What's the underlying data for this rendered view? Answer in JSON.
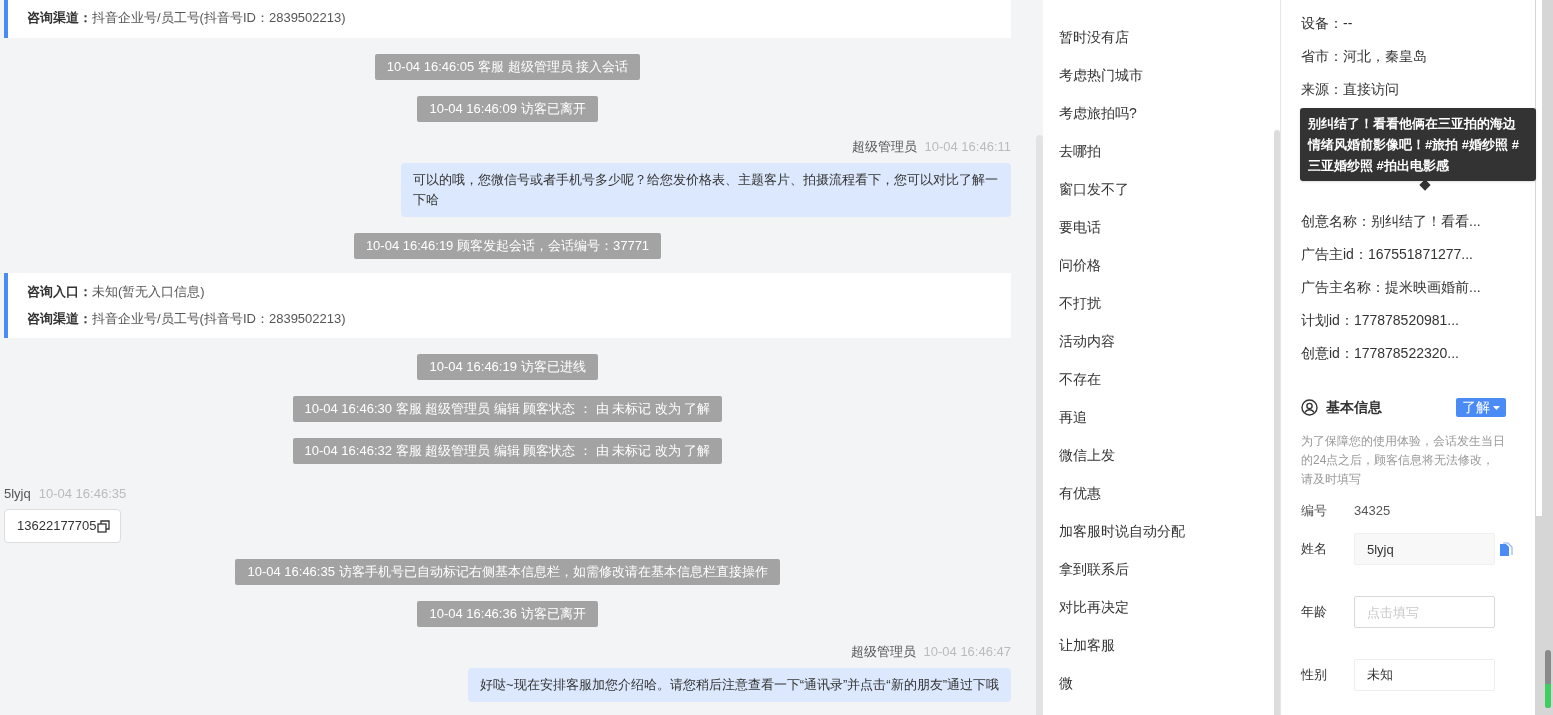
{
  "chat": {
    "items": [
      {
        "kind": "source_card",
        "rows": [
          {
            "label": "咨询渠道：",
            "value": "抖音企业号/员工号(抖音号ID：2839502213)"
          }
        ]
      },
      {
        "kind": "system",
        "text": "10-04 16:46:05 客服 超级管理员 接入会话"
      },
      {
        "kind": "system",
        "text": "10-04 16:46:09 访客已离开"
      },
      {
        "kind": "agent_message",
        "sender": "超级管理员",
        "time": "10-04 16:46:11",
        "text": "可以的哦，您微信号或者手机号多少呢？给您发价格表、主题客片、拍摄流程看下，您可以对比了解一下哈"
      },
      {
        "kind": "system",
        "text": "10-04 16:46:19 顾客发起会话，会话编号：37771"
      },
      {
        "kind": "source_card",
        "rows": [
          {
            "label": "咨询入口：",
            "value": "未知(暂无入口信息)"
          },
          {
            "label": "咨询渠道：",
            "value": "抖音企业号/员工号(抖音号ID：2839502213)"
          }
        ]
      },
      {
        "kind": "system",
        "text": "10-04 16:46:19 访客已进线"
      },
      {
        "kind": "system",
        "text": "10-04 16:46:30 客服 超级管理员 编辑 顾客状态 ： 由 未标记 改为 了解"
      },
      {
        "kind": "system",
        "text": "10-04 16:46:32 客服 超级管理员 编辑 顾客状态 ： 由 未标记 改为 了解"
      },
      {
        "kind": "visitor_message",
        "sender": "5lyjq",
        "time": "10-04 16:46:35",
        "text": "13622177705"
      },
      {
        "kind": "system",
        "text": "10-04 16:46:35 访客手机号已自动标记右侧基本信息栏，如需修改请在基本信息栏直接操作"
      },
      {
        "kind": "system",
        "text": "10-04 16:46:36 访客已离开"
      },
      {
        "kind": "agent_message",
        "sender": "超级管理员",
        "time": "10-04 16:46:47",
        "text": "好哒~现在安排客服加您介绍哈。请您稍后注意查看一下“通讯录”并点击“新的朋友”通过下哦"
      }
    ]
  },
  "quick_replies": [
    "暂时没有店",
    "考虑热门城市",
    "考虑旅拍吗?",
    "去哪拍",
    "窗口发不了",
    "要电话",
    "问价格",
    "不打扰",
    "活动内容",
    "不存在",
    "再追",
    "微信上发",
    "有优惠",
    "加客服时说自动分配",
    "拿到联系后",
    "对比再决定",
    "让加客服",
    "微"
  ],
  "visitor_info": {
    "fields_above": [
      "设备：--",
      "省市：河北，秦皇岛",
      "来源：直接访问"
    ],
    "tooltip": "别纠结了！看看他俩在三亚拍的海边情绪风婚前影像吧！#旅拍 #婚纱照 #三亚婚纱照 #拍出电影感",
    "fields_below": [
      "创意名称：别纠结了！看看...",
      "广告主id：167551871277...",
      "广告主名称：提米映画婚前...",
      "计划id：177878520981...",
      "创意id：177878522320..."
    ]
  },
  "basic_info": {
    "title": "基本信息",
    "status": "了解",
    "note": "为了保障您的使用体验，会话发生当日的24点之后，顾客信息将无法修改，请及时填写",
    "number_label": "编号",
    "number": "34325",
    "fields": [
      {
        "label": "姓名",
        "value": "5lyjq",
        "kind": "readonly"
      },
      {
        "label": "年龄",
        "placeholder": "点击填写",
        "kind": "input"
      },
      {
        "label": "性别",
        "value": "未知",
        "kind": "input"
      }
    ]
  }
}
